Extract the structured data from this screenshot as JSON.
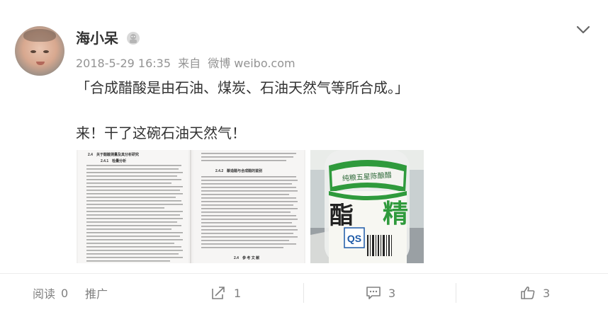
{
  "post": {
    "username": "海小呆",
    "date": "2018-5-29 16:35",
    "from_label": "来自",
    "source": "微博 weibo.com",
    "line1": "「合成醋酸是由石油、煤炭、石油天然气等所合成。」",
    "line2": "来！干了这碗石油天然气！"
  },
  "images": {
    "doc_left_title": "2.4　关于醋酸测量及其分析研究",
    "doc_left_sub": "2.4.1　检量分析",
    "doc_right_sub": "2.4.2　酿造醋与合成醋的鉴别",
    "doc_right_foot": "2.4　参 考 文 献",
    "bottle_label": "纯粮五星陈酿醋",
    "bottle_char_a": "酯",
    "bottle_char_b": "精"
  },
  "actions": {
    "read_label": "阅读",
    "read_count": "0",
    "promote_label": "推广",
    "share_count": "1",
    "comment_count": "3",
    "like_count": "3"
  },
  "colors": {
    "text": "#333333",
    "meta": "#939393",
    "action": "#808080",
    "bottle_green": "#2f9a3c"
  },
  "icons": {
    "chevron": "chevron-down-icon",
    "badge": "member-badge-icon",
    "share": "share-icon",
    "comment": "comment-icon",
    "like": "thumbs-up-icon"
  }
}
